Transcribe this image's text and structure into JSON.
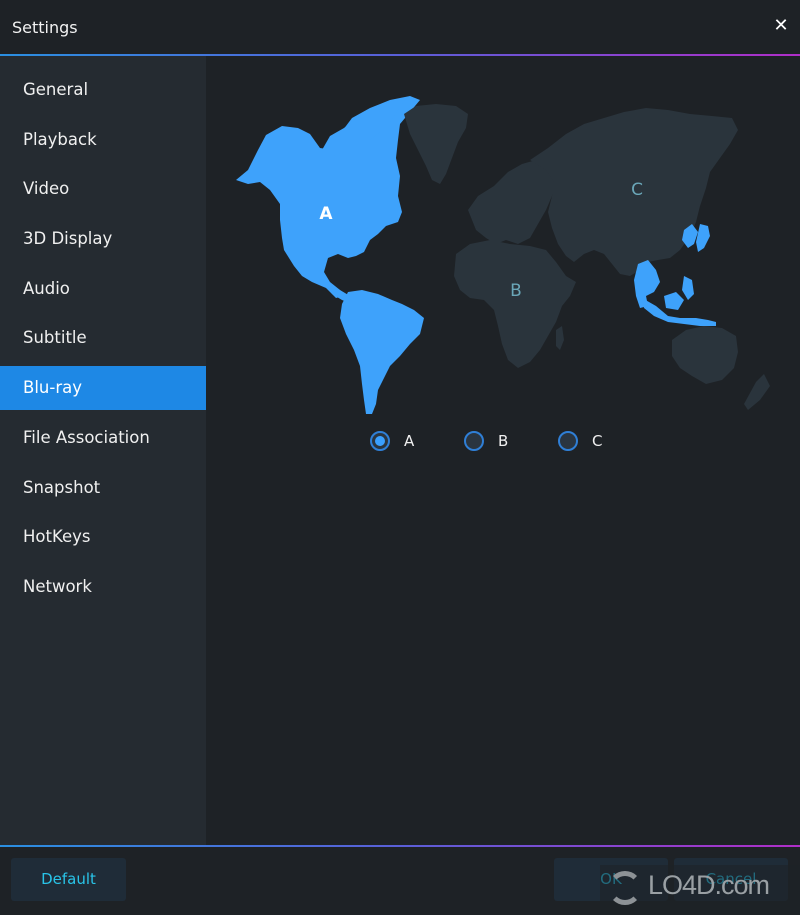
{
  "window": {
    "title": "Settings",
    "close_icon": "close-x-icon"
  },
  "sidebar": {
    "items": [
      {
        "label": "General",
        "active": false
      },
      {
        "label": "Playback",
        "active": false
      },
      {
        "label": "Video",
        "active": false
      },
      {
        "label": "3D Display",
        "active": false
      },
      {
        "label": "Audio",
        "active": false
      },
      {
        "label": "Subtitle",
        "active": false
      },
      {
        "label": "Blu-ray",
        "active": true
      },
      {
        "label": "File Association",
        "active": false
      },
      {
        "label": "Snapshot",
        "active": false
      },
      {
        "label": "HotKeys",
        "active": false
      },
      {
        "label": "Network",
        "active": false
      }
    ]
  },
  "region_map": {
    "labels": {
      "a": "A",
      "b": "B",
      "c": "C"
    },
    "selected_region": "A",
    "colors": {
      "selected": "#3ea2fb",
      "unselected": "#2a343c",
      "label_selected": "#ffffff",
      "label_unselected": "#6aa6b8"
    }
  },
  "region_options": [
    {
      "label": "A",
      "checked": true
    },
    {
      "label": "B",
      "checked": false
    },
    {
      "label": "C",
      "checked": false
    }
  ],
  "footer": {
    "default_label": "Default",
    "ok_label": "OK",
    "cancel_label": "Cancel"
  },
  "watermark": {
    "text": "LO4D.com"
  },
  "colors": {
    "accent": "#1e88e5",
    "button_text": "#29c4e8",
    "background": "#1e2226",
    "sidebar": "#252b31"
  }
}
